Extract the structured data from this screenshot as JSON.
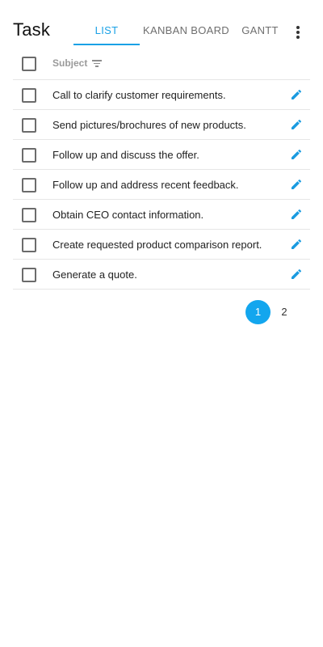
{
  "header": {
    "title": "Task",
    "tabs": [
      {
        "label": "List",
        "active": true
      },
      {
        "label": "Kanban Board",
        "active": false
      },
      {
        "label": "Gantt",
        "active": false
      }
    ],
    "more_icon": "more-vertical-icon"
  },
  "table": {
    "columns": [
      {
        "label": "Subject",
        "icon": "filter-icon"
      }
    ],
    "rows": [
      {
        "subject": "Call to clarify customer requirements.",
        "action_icon": "edit-icon"
      },
      {
        "subject": "Send pictures/brochures of new products.",
        "action_icon": "edit-icon"
      },
      {
        "subject": "Follow up and discuss the offer.",
        "action_icon": "edit-icon"
      },
      {
        "subject": "Follow up and address recent feedback.",
        "action_icon": "edit-icon"
      },
      {
        "subject": "Obtain CEO contact information.",
        "action_icon": "edit-icon"
      },
      {
        "subject": "Create requested product comparison report.",
        "action_icon": "edit-icon"
      },
      {
        "subject": "Generate a quote.",
        "action_icon": "edit-icon"
      }
    ]
  },
  "pagination": {
    "pages": [
      "1",
      "2"
    ],
    "current": "1"
  },
  "colors": {
    "accent": "#1aa1e6",
    "current_page": "#13a6ee",
    "edit_icon": "#1a9be0"
  }
}
